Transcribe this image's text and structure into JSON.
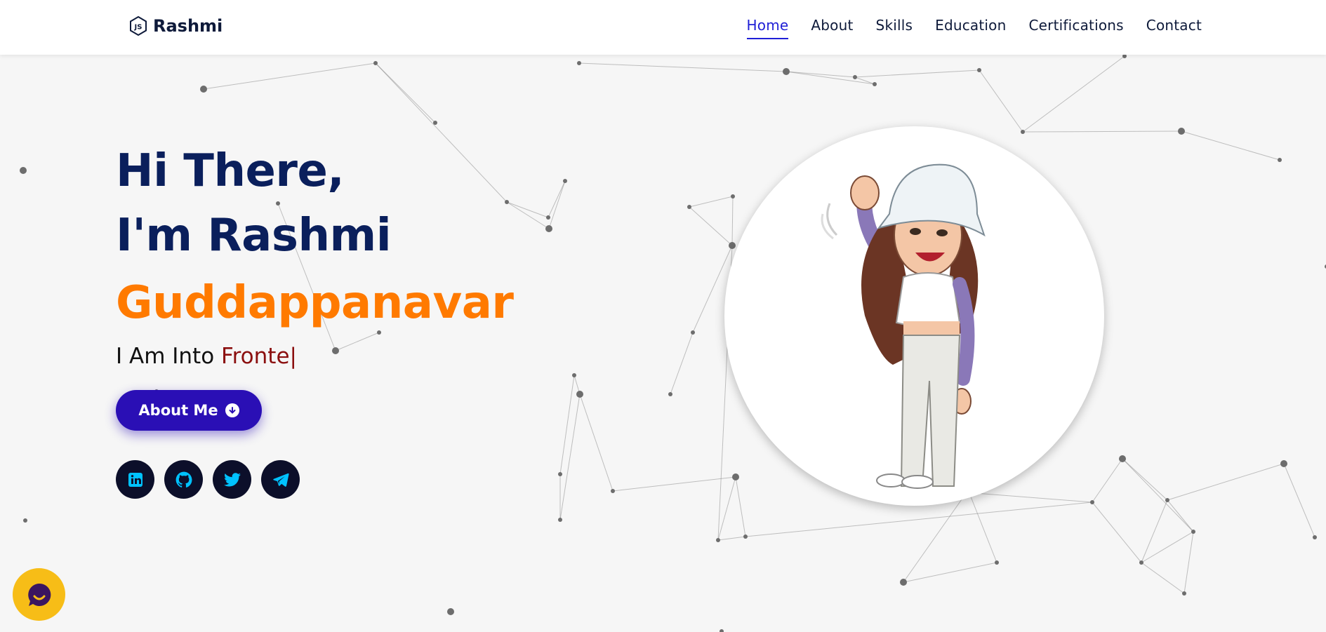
{
  "header": {
    "logo_text": "Rashmi",
    "logo_icon": "js-hexagon-icon",
    "nav": [
      {
        "label": "Home",
        "active": true
      },
      {
        "label": "About"
      },
      {
        "label": "Skills"
      },
      {
        "label": "Education"
      },
      {
        "label": "Certifications"
      },
      {
        "label": "Contact"
      }
    ]
  },
  "hero": {
    "greeting": "Hi There,",
    "name_line": "I'm Rashmi",
    "surname": "Guddappanavar",
    "typing_prefix": "I Am Into",
    "typing_role": "Fronte|",
    "about_button": "About Me",
    "socials": [
      "linkedin-icon",
      "github-icon",
      "twitter-icon",
      "telegram-icon"
    ]
  },
  "colors": {
    "primary_dark": "#0a1f5c",
    "accent_orange": "#ff7a00",
    "accent_red": "#8b0f0f",
    "button_blue": "#2a0fb5",
    "social_icon": "#00c2ff",
    "chat_yellow": "#f7bd17"
  }
}
